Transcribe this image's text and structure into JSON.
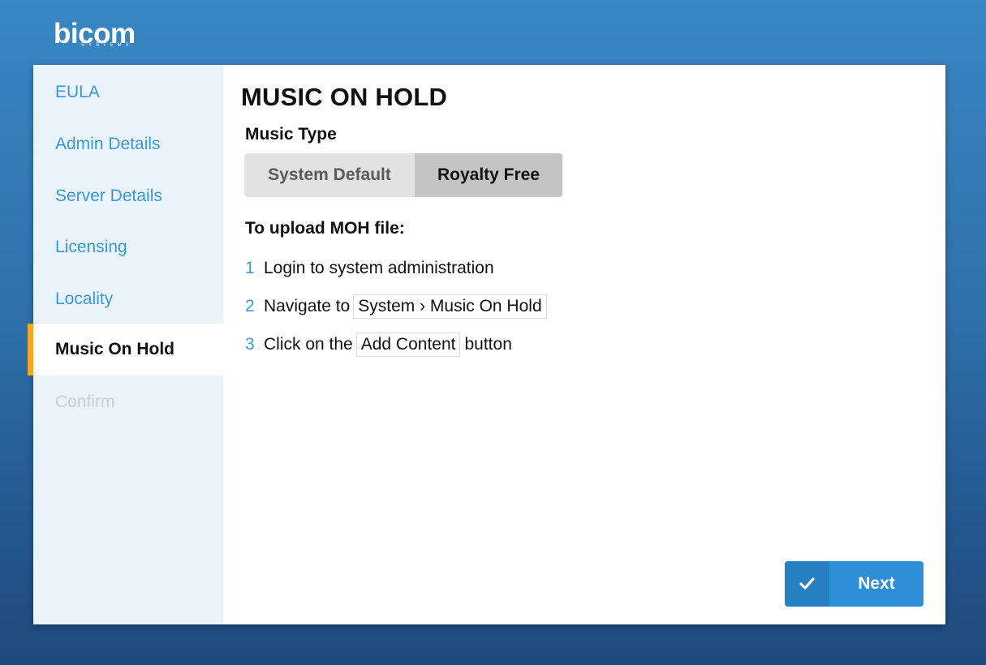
{
  "logo": {
    "word": "bicom",
    "sub": "SYSTEMS"
  },
  "sidebar": {
    "items": [
      {
        "label": "EULA",
        "state": "normal"
      },
      {
        "label": "Admin Details",
        "state": "normal"
      },
      {
        "label": "Server Details",
        "state": "normal"
      },
      {
        "label": "Licensing",
        "state": "normal"
      },
      {
        "label": "Locality",
        "state": "normal"
      },
      {
        "label": "Music On Hold",
        "state": "active"
      },
      {
        "label": "Confirm",
        "state": "disabled"
      }
    ]
  },
  "main": {
    "title": "MUSIC ON HOLD",
    "music_type_label": "Music Type",
    "music_type_options": [
      "System Default",
      "Royalty Free"
    ],
    "music_type_selected": "Royalty Free",
    "upload_title": "To upload MOH file:",
    "steps": [
      {
        "num": "1",
        "before": "Login to system administration",
        "code": "",
        "after": ""
      },
      {
        "num": "2",
        "before": "Navigate to",
        "code": "System › Music On Hold",
        "after": ""
      },
      {
        "num": "3",
        "before": "Click on the",
        "code": "Add Content",
        "after": "button"
      }
    ]
  },
  "footer": {
    "next_label": "Next",
    "next_icon": "check-icon"
  },
  "colors": {
    "accent": "#3a9ad3",
    "active_marker": "#f5a623",
    "button": "#2d8fd6"
  }
}
